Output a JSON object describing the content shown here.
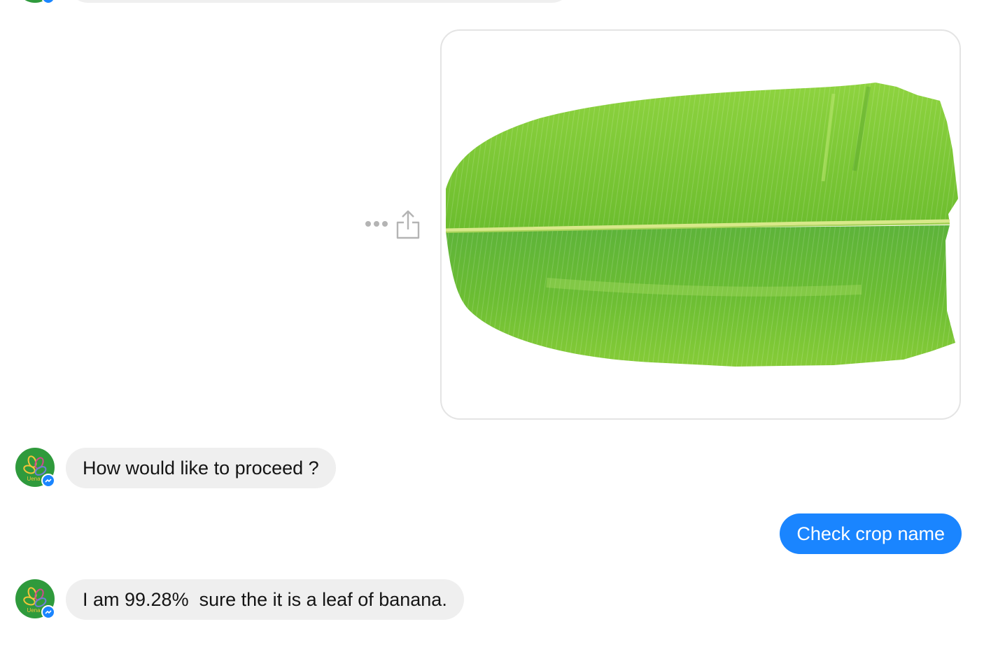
{
  "conversation": {
    "messages": [
      {
        "sender": "bot",
        "type": "text",
        "text": ""
      },
      {
        "sender": "user",
        "type": "image",
        "image_icon": "banana-leaf-photo"
      },
      {
        "sender": "bot",
        "type": "text",
        "text": "How would like to proceed ?"
      },
      {
        "sender": "user",
        "type": "text",
        "text": "Check crop name"
      },
      {
        "sender": "bot",
        "type": "text",
        "text": "I am 99.28%  sure the it is a leaf of banana."
      }
    ]
  },
  "bot": {
    "avatar_icon": "bot-logo-icon",
    "avatar_text": "Uena",
    "badge_icon": "messenger-badge-icon"
  },
  "actions": {
    "more_icon": "more-options-icon",
    "share_icon": "share-icon"
  },
  "colors": {
    "outgoing_bubble": "#1a85ff",
    "incoming_bubble": "#efefef",
    "avatar_bg": "#2f9a3c",
    "leaf_green": "#7cc83a"
  }
}
